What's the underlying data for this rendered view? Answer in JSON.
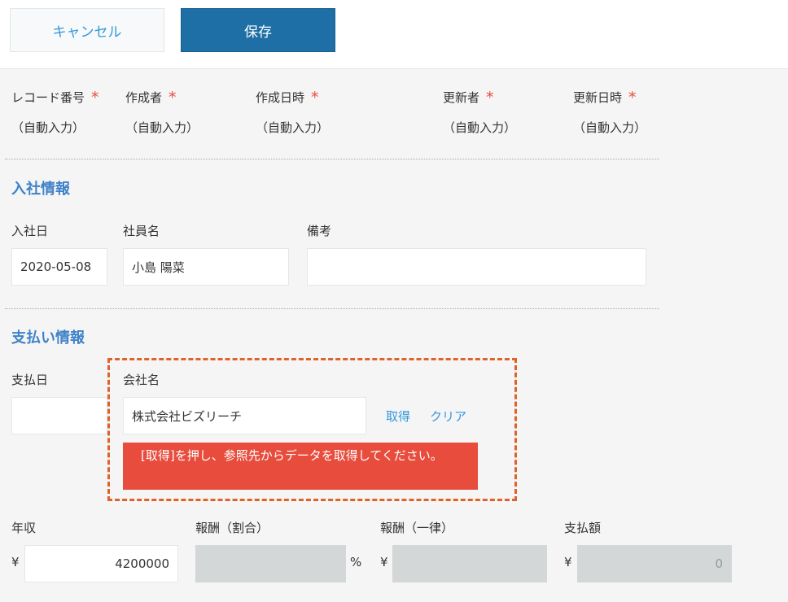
{
  "toolbar": {
    "cancel_label": "キャンセル",
    "save_label": "保存"
  },
  "system_fields": [
    {
      "label": "レコード番号",
      "required": "*",
      "value": "（自動入力）"
    },
    {
      "label": "作成者",
      "required": "*",
      "value": "（自動入力）"
    },
    {
      "label": "作成日時",
      "required": "*",
      "value": "（自動入力）"
    },
    {
      "label": "更新者",
      "required": "*",
      "value": "（自動入力）"
    },
    {
      "label": "更新日時",
      "required": "*",
      "value": "（自動入力）"
    }
  ],
  "joining_section": {
    "title": "入社情報",
    "join_date_label": "入社日",
    "join_date_value": "2020-05-08",
    "employee_name_label": "社員名",
    "employee_name_value": "小島 陽菜",
    "notes_label": "備考",
    "notes_value": ""
  },
  "payment_section": {
    "title": "支払い情報",
    "payment_date_label": "支払日",
    "payment_date_value": "",
    "company_label": "会社名",
    "company_value": "株式会社ビズリーチ",
    "fetch_link": "取得",
    "clear_link": "クリア",
    "error_message": "[取得]を押し、参照先からデータを取得してください。",
    "annual_income_label": "年収",
    "annual_income_unit": "¥",
    "annual_income_value": "4200000",
    "reward_rate_label": "報酬（割合）",
    "reward_rate_value": "",
    "reward_rate_unit": "%",
    "reward_flat_label": "報酬（一律）",
    "reward_flat_unit": "¥",
    "reward_flat_value": "",
    "payment_amount_label": "支払額",
    "payment_amount_unit": "¥",
    "payment_amount_value": "0"
  },
  "colors": {
    "accent": "#1d6fa5",
    "link": "#3498db",
    "error": "#e74c3c",
    "highlight_border": "#e0622b",
    "section_title": "#3f82c8"
  }
}
